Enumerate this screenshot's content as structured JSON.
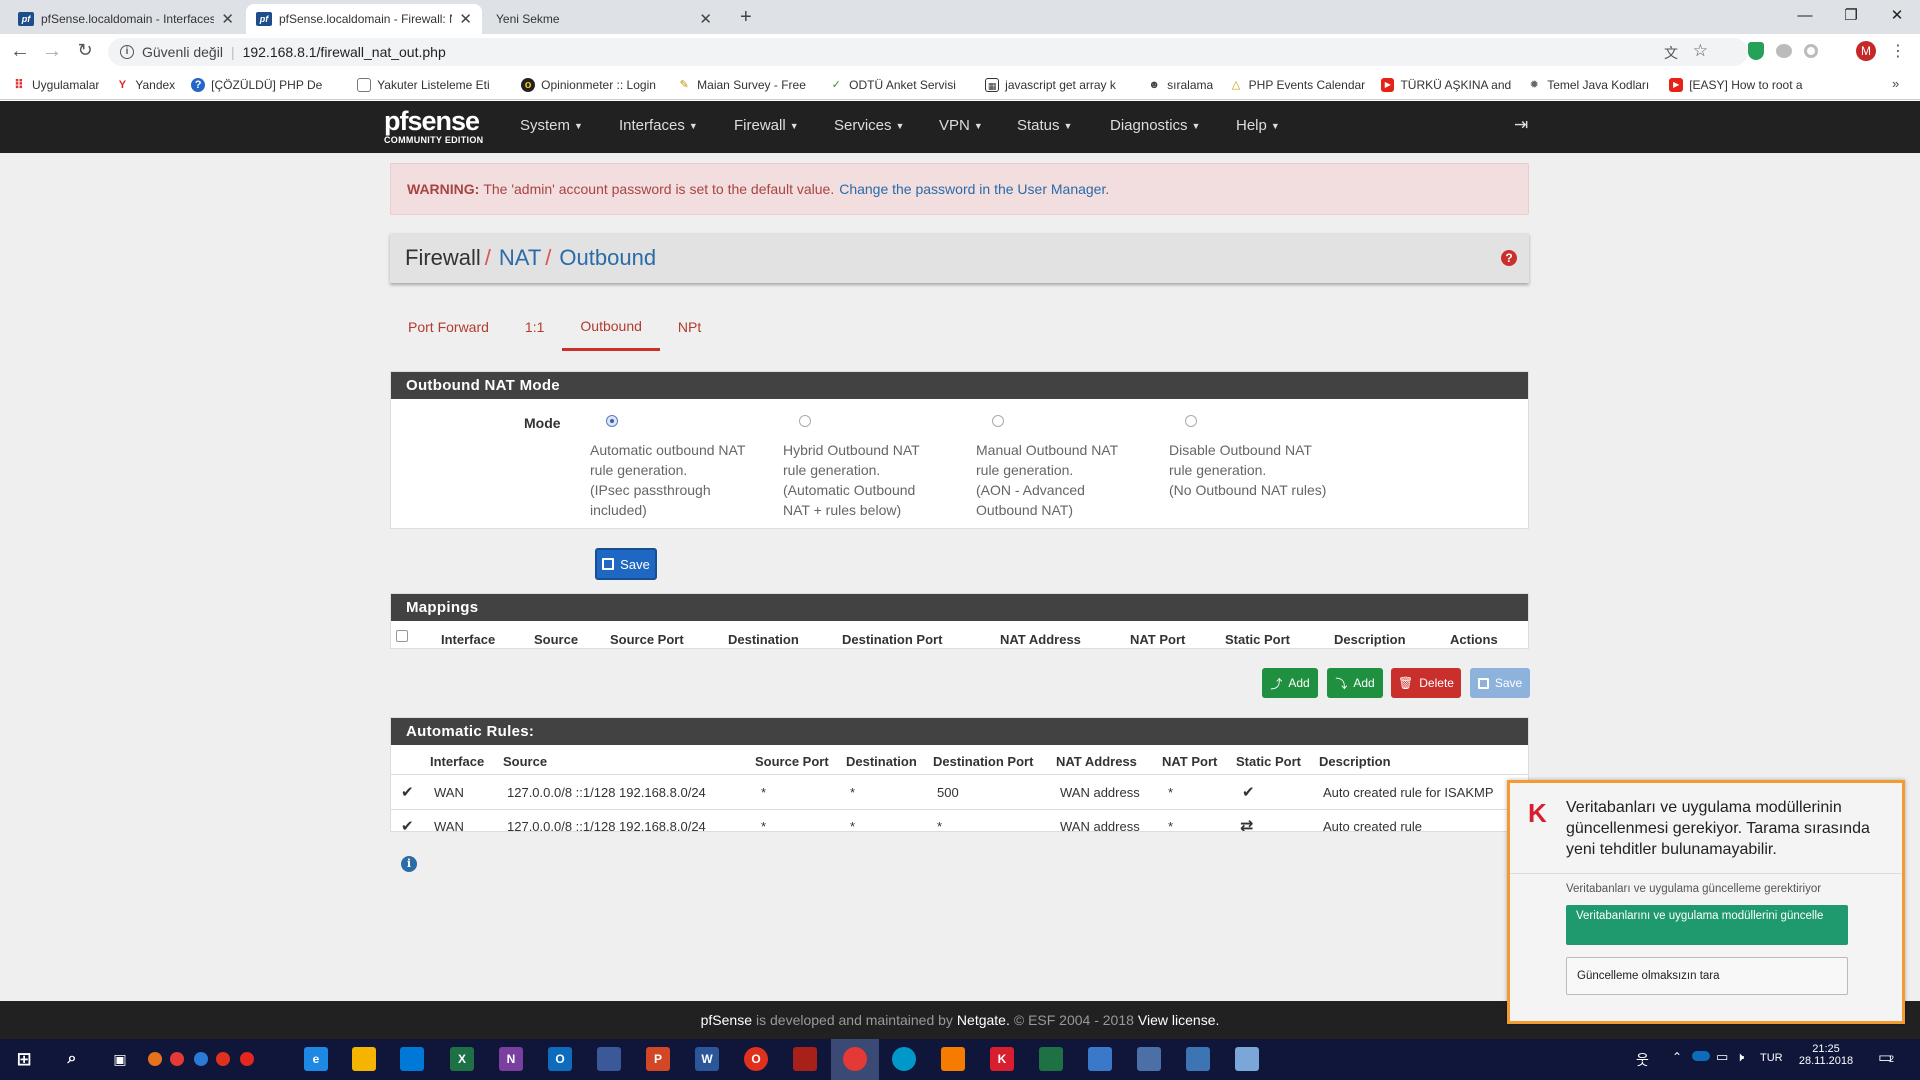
{
  "browser": {
    "tabs": [
      {
        "title": "pfSense.localdomain - Interfaces"
      },
      {
        "title": "pfSense.localdomain - Firewall: N"
      },
      {
        "title": "Yeni Sekme"
      }
    ],
    "security_label": "Güvenli değil",
    "url": "192.168.8.1/firewall_nat_out.php",
    "profile_initial": "M",
    "bookmarks": [
      {
        "label": "Uygulamalar"
      },
      {
        "label": "Yandex"
      },
      {
        "label": "[ÇÖZÜLDÜ] PHP De"
      },
      {
        "label": "Yakuter Listeleme Eti"
      },
      {
        "label": "Opinionmeter :: Login"
      },
      {
        "label": "Maian Survey - Free"
      },
      {
        "label": "ODTÜ Anket Servisi"
      },
      {
        "label": "javascript get array k"
      },
      {
        "label": "sıralama"
      },
      {
        "label": "PHP Events Calendar"
      },
      {
        "label": "TÜRKÜ AŞKINA and"
      },
      {
        "label": "Temel Java Kodları"
      },
      {
        "label": "[EASY] How to root a"
      }
    ]
  },
  "pfsense": {
    "logo_text": "pfsense",
    "logo_sub": "COMMUNITY EDITION",
    "menu": [
      "System",
      "Interfaces",
      "Firewall",
      "Services",
      "VPN",
      "Status",
      "Diagnostics",
      "Help"
    ],
    "alert": {
      "label": "WARNING:",
      "text": "The 'admin' account password is set to the default value.",
      "link": "Change the password in the User Manager."
    },
    "breadcrumb": [
      "Firewall",
      "NAT",
      "Outbound"
    ],
    "tabs": [
      "Port Forward",
      "1:1",
      "Outbound",
      "NPt"
    ],
    "active_tab": "Outbound",
    "mode_panel": {
      "title": "Outbound NAT Mode",
      "label": "Mode",
      "options": [
        {
          "line1": "Automatic outbound NAT",
          "line2": "rule generation.",
          "line3": "(IPsec passthrough",
          "line4": "included)",
          "checked": true
        },
        {
          "line1": "Hybrid Outbound NAT",
          "line2": "rule generation.",
          "line3": "(Automatic Outbound",
          "line4": "NAT + rules below)",
          "checked": false
        },
        {
          "line1": "Manual Outbound NAT",
          "line2": "rule generation.",
          "line3": "(AON - Advanced",
          "line4": "Outbound NAT)",
          "checked": false
        },
        {
          "line1": "Disable Outbound NAT",
          "line2": "rule generation.",
          "line3": "(No Outbound NAT rules)",
          "line4": "",
          "checked": false
        }
      ],
      "save_label": "Save"
    },
    "mappings": {
      "title": "Mappings",
      "columns": [
        "Interface",
        "Source",
        "Source Port",
        "Destination",
        "Destination Port",
        "NAT Address",
        "NAT Port",
        "Static Port",
        "Description",
        "Actions"
      ],
      "buttons": {
        "add1": "Add",
        "add2": "Add",
        "delete": "Delete",
        "save": "Save"
      }
    },
    "auto_rules": {
      "title": "Automatic Rules:",
      "columns": [
        "Interface",
        "Source",
        "Source Port",
        "Destination",
        "Destination Port",
        "NAT Address",
        "NAT Port",
        "Static Port",
        "Description"
      ],
      "rows": [
        {
          "interface": "WAN",
          "source": "127.0.0.0/8 ::1/128 192.168.8.0/24",
          "source_port": "*",
          "destination": "*",
          "destination_port": "500",
          "nat_address": "WAN address",
          "nat_port": "*",
          "static_port_icon": "check-icon",
          "description": "Auto created rule for ISAKMP"
        },
        {
          "interface": "WAN",
          "source": "127.0.0.0/8 ::1/128 192.168.8.0/24",
          "source_port": "*",
          "destination": "*",
          "destination_port": "*",
          "nat_address": "WAN address",
          "nat_port": "*",
          "static_port_icon": "shuffle-icon",
          "description": "Auto created rule"
        }
      ]
    },
    "footer": {
      "brand": "pfSense",
      "text1": "is developed and maintained by",
      "company": "Netgate.",
      "text2": "© ESF 2004 - 2018",
      "license": "View license."
    }
  },
  "kaspersky": {
    "message": "Veritabanları ve uygulama modüllerinin güncellenmesi gerekiyor. Tarama sırasında yeni tehditler bulunamayabilir.",
    "sub": "Veritabanları ve uygulama güncelleme gerektiriyor",
    "primary_button": "Veritabanlarını ve uygulama modüllerini güncelle",
    "secondary_button": "Güncelleme olmaksızın tara"
  },
  "taskbar": {
    "language": "TUR",
    "time": "21:25",
    "date": "28.11.2018",
    "notifications": "2"
  },
  "colors": {
    "nav_bg": "#212121",
    "panel_header": "#424242",
    "accent_red": "#c9302c",
    "link_blue": "#2a6ba8",
    "kaspersky_border": "#f19b32",
    "kaspersky_green": "#1f9a6f"
  }
}
